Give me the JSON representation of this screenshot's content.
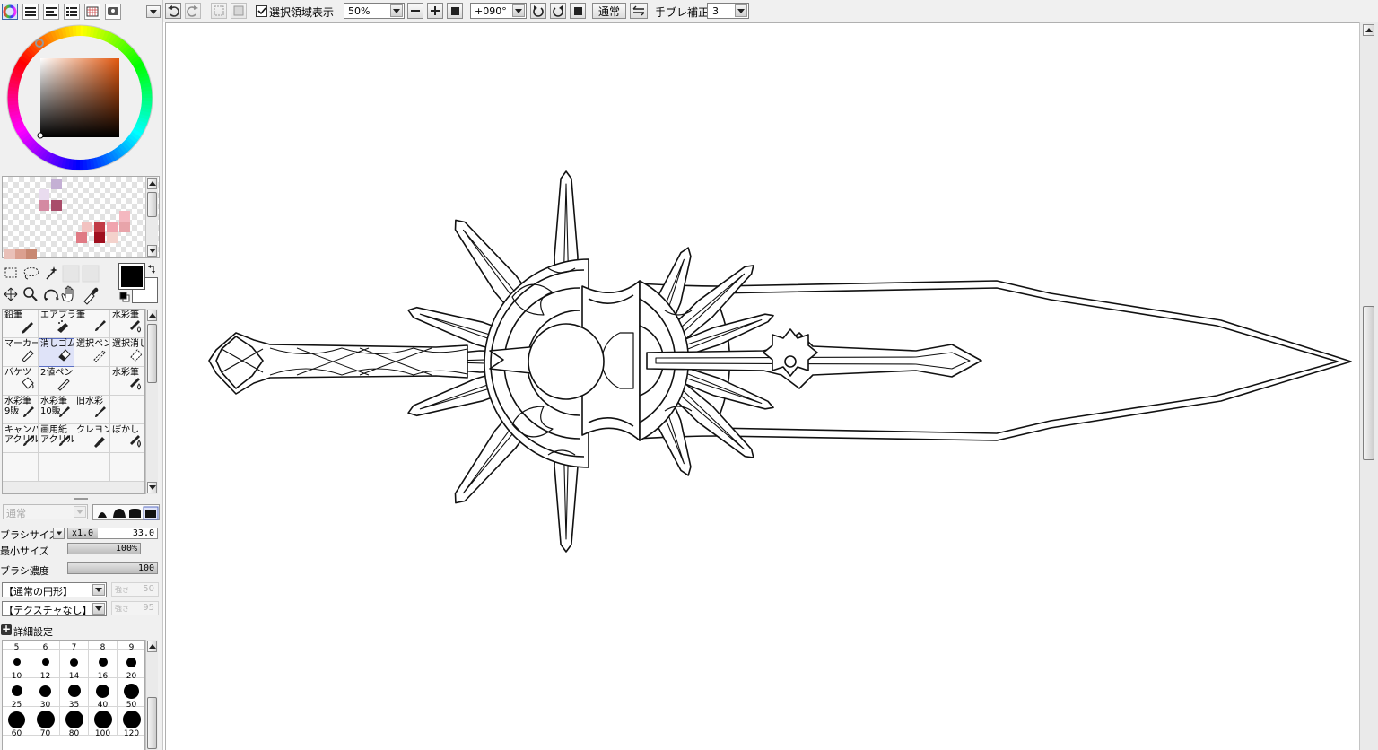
{
  "panel_tabs": [
    {
      "icon": "color-wheel-icon",
      "selected": true
    },
    {
      "icon": "rgb-sliders-icon",
      "selected": false
    },
    {
      "icon": "hsv-sliders-icon",
      "selected": false
    },
    {
      "icon": "list-icon",
      "selected": false
    },
    {
      "icon": "swatch-grid-icon",
      "selected": false
    },
    {
      "icon": "scratchpad-icon",
      "selected": false
    }
  ],
  "colors": {
    "foreground": "#000000",
    "background": "#ffffff",
    "accent": "#5b6fc3",
    "palette_swatches": [
      "#c4b0d4",
      "#e9dcef",
      "#d48aa2",
      "#a94c6a",
      "#f4b8c0",
      "#f0a4ae",
      "#c23b46",
      "#9f0f1e",
      "#e8a4aa",
      "#f4d2cc",
      "#f2c2c0",
      "#e07a84",
      "#e9c0b8",
      "#dba090",
      "#c88872"
    ]
  },
  "tool_grid": {
    "tools": [
      {
        "label": "鉛筆",
        "icon": "pencil-icon",
        "selected": false
      },
      {
        "label": "エアブラシ",
        "icon": "airbrush-icon",
        "selected": false
      },
      {
        "label": "筆",
        "icon": "brush-icon",
        "selected": false
      },
      {
        "label": "水彩筆",
        "icon": "watercolor-icon",
        "selected": false
      },
      {
        "label": "マーカー",
        "icon": "marker-icon",
        "selected": false
      },
      {
        "label": "消しゴム",
        "icon": "eraser-icon",
        "selected": true
      },
      {
        "label": "選択ペン",
        "icon": "select-pen-icon",
        "selected": false
      },
      {
        "label": "選択消し",
        "icon": "select-erase-icon",
        "selected": false
      },
      {
        "label": "バケツ",
        "icon": "bucket-icon",
        "selected": false
      },
      {
        "label": "2値ペン",
        "icon": "binary-pen-icon",
        "selected": false
      },
      {
        "label": "",
        "icon": "",
        "selected": false
      },
      {
        "label": "水彩筆",
        "icon": "watercolor-icon",
        "selected": false
      },
      {
        "label": "水彩筆\n9販",
        "icon": "brush-icon",
        "selected": false
      },
      {
        "label": "水彩筆\n10販",
        "icon": "brush-icon",
        "selected": false
      },
      {
        "label": "旧水彩",
        "icon": "brush-icon",
        "selected": false
      },
      {
        "label": "",
        "icon": "",
        "selected": false
      },
      {
        "label": "キャンバス\nアクリル",
        "icon": "brush-icon",
        "selected": false
      },
      {
        "label": "画用紙\nアクリル",
        "icon": "brush-icon",
        "selected": false
      },
      {
        "label": "クレヨン",
        "icon": "crayon-icon",
        "selected": false
      },
      {
        "label": "ぼかし",
        "icon": "blur-icon",
        "selected": false
      }
    ]
  },
  "blend_mode": "通常",
  "brush_settings": {
    "size_label": "ブラシサイズ",
    "size_multiplier": "x1.0",
    "size_value": "33.0",
    "min_size_label": "最小サイズ",
    "min_size_value": "100%",
    "min_size_fraction": 1.0,
    "density_label": "ブラシ濃度",
    "density_value": "100",
    "density_fraction": 1.0,
    "shape": "【通常の円形】",
    "shape_strength_label": "強さ",
    "shape_strength": "50",
    "texture": "【テクスチャなし】",
    "texture_strength_label": "強さ",
    "texture_strength": "95",
    "advanced_label": "詳細設定"
  },
  "brush_sizes": [
    "5",
    "6",
    "7",
    "8",
    "9",
    "10",
    "12",
    "14",
    "16",
    "20",
    "25",
    "30",
    "35",
    "40",
    "50",
    "60",
    "70",
    "80",
    "100",
    "120"
  ],
  "toolbar": {
    "selection_display_label": "選択領域表示",
    "selection_display_checked": true,
    "zoom": "50%",
    "rotation": "+090°",
    "blend": "通常",
    "stabilizer_label": "手ブレ補正",
    "stabilizer_value": "3"
  }
}
